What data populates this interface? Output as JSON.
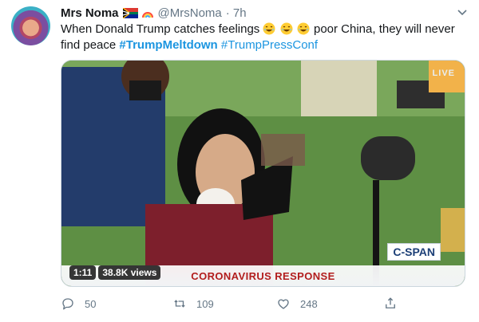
{
  "user": {
    "name": "Mrs Noma",
    "handle": "@MrsNoma",
    "time": "· 7h"
  },
  "tweet": {
    "text_part1": "When Donald Trump catches feelings ",
    "text_part2": " poor China, they will never find peace ",
    "hashtag_1": "#TrumpMeltdown",
    "hashtag_2": "#TrumpPressConf"
  },
  "media": {
    "live_label": "LIVE",
    "duration": "1:11",
    "views": "38.8K views",
    "network_label": "C-SPAN",
    "lower_third": "CORONAVIRUS RESPONSE"
  },
  "actions": {
    "reply_count": "50",
    "retweet_count": "109",
    "like_count": "248"
  },
  "colors": {
    "link": "#1b95e0",
    "muted": "#657786",
    "lower_third_text": "#b21d1d"
  }
}
